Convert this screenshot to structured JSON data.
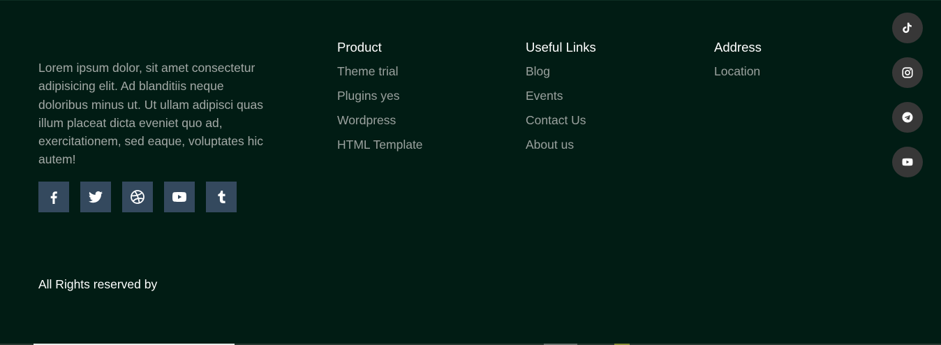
{
  "about": {
    "text": "Lorem ipsum dolor, sit amet consectetur adipisicing elit. Ad blanditiis neque doloribus minus ut. Ut ullam adipisci quas illum placeat dicta eveniet quo ad, exercitationem, sed eaque, voluptates hic autem!"
  },
  "social_row": [
    {
      "icon": "facebook-icon"
    },
    {
      "icon": "twitter-icon"
    },
    {
      "icon": "dribbble-icon"
    },
    {
      "icon": "youtube-icon"
    },
    {
      "icon": "tumblr-icon"
    }
  ],
  "columns": {
    "product": {
      "title": "Product",
      "items": [
        "Theme trial",
        "Plugins yes",
        "Wordpress",
        "HTML Template"
      ]
    },
    "useful_links": {
      "title": "Useful Links",
      "items": [
        "Blog",
        "Events",
        "Contact Us",
        "About us"
      ]
    },
    "address": {
      "title": "Address",
      "items": [
        "Location"
      ]
    }
  },
  "copyright": "All Rights reserved by",
  "floating_social": [
    {
      "icon": "tiktok-icon"
    },
    {
      "icon": "instagram-icon"
    },
    {
      "icon": "telegram-icon"
    },
    {
      "icon": "youtube-icon"
    }
  ],
  "colors": {
    "background": "#011c14",
    "social_square": "#34495e",
    "floating_circle": "#373737",
    "heading": "#ffffff",
    "link": "#9aa19e"
  }
}
